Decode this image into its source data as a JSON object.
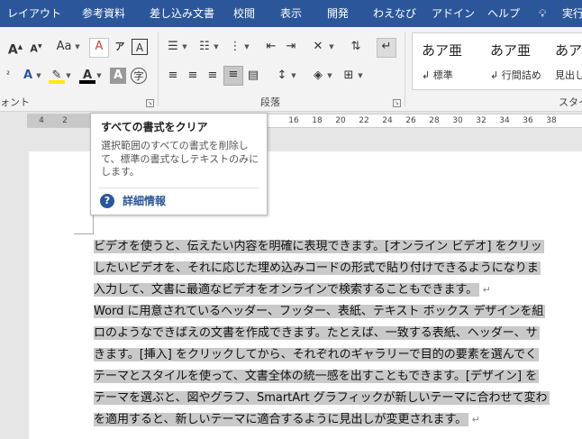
{
  "tabs": {
    "layout": "レイアウト",
    "references": "参考資料",
    "mailings": "差し込み文書",
    "review": "校閲",
    "view": "表示",
    "developer": "開発",
    "wanabi": "わえなび",
    "addin": "アドイン",
    "help": "ヘルプ",
    "tell_me": "実行"
  },
  "ribbon": {
    "font_group": "ォント",
    "paragraph_group": "段落",
    "styles_group": "スタイ",
    "font_change_case": "Aa",
    "styles": [
      {
        "sample": "あア亜",
        "name": "↲ 標準"
      },
      {
        "sample": "あア亜",
        "name": "↲ 行間詰め"
      },
      {
        "sample": "あア",
        "name": "見出し"
      }
    ]
  },
  "ruler": {
    "ticks": [
      "4",
      "2",
      "16",
      "18",
      "20",
      "22",
      "24",
      "26",
      "28",
      "30",
      "32",
      "34",
      "36",
      "38"
    ]
  },
  "document": {
    "lines": [
      "ビデオを使うと、伝えたい内容を明確に表現できます。[オンライン ビデオ] をクリッ",
      "したいビデオを、それに応じた埋め込みコードの形式で貼り付けできるようになりま",
      "入力して、文書に最適なビデオをオンラインで検索することもできます。",
      "Word に用意されているヘッダー、フッター、表紙、テキスト ボックス デザインを組",
      "ロのようなできばえの文書を作成できます。たとえば、一致する表紙、ヘッダー、サ",
      "きます。[挿入] をクリックしてから、それぞれのギャラリーで目的の要素を選んでく",
      "テーマとスタイルを使って、文書全体の統一感を出すこともできます。[デザイン] を",
      "テーマを選ぶと、図やグラフ、SmartArt グラフィックが新しいテーマに合わせて変わ",
      "を適用すると、新しいテーマに適合するように見出しが変更されます。"
    ]
  },
  "tooltip": {
    "title": "すべての書式をクリア",
    "description": "選択範囲のすべての書式を削除して、標準の書式なしテキストのみにします。",
    "help_link": "詳細情報",
    "help_icon": "?"
  },
  "colors": {
    "accent": "#2b579a",
    "highlight": "#c9c9c9"
  }
}
